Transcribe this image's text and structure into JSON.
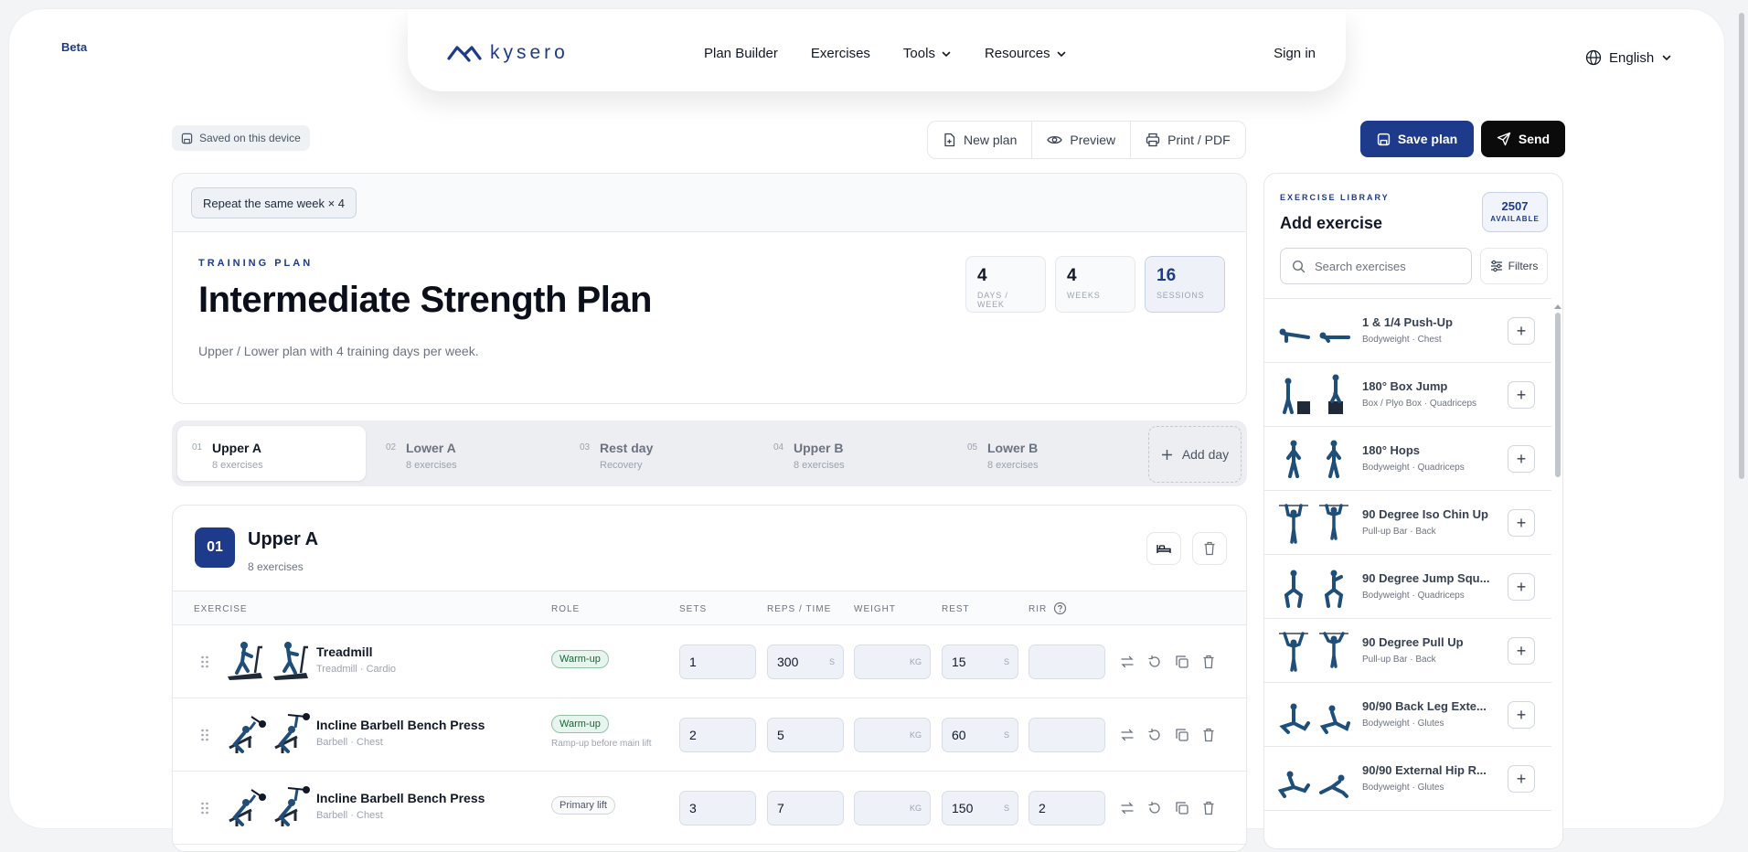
{
  "app": {
    "beta": "Beta",
    "brand": "kysero"
  },
  "nav": {
    "links": [
      {
        "label": "Plan Builder"
      },
      {
        "label": "Exercises"
      },
      {
        "label": "Tools"
      },
      {
        "label": "Resources"
      }
    ],
    "signin": "Sign in",
    "language": "English"
  },
  "toolbar": {
    "saved": "Saved on this device",
    "new_plan": "New plan",
    "preview": "Preview",
    "print": "Print / PDF",
    "save": "Save plan",
    "send": "Send"
  },
  "plan": {
    "repeat": "Repeat the same week × 4",
    "eyebrow": "TRAINING PLAN",
    "title": "Intermediate Strength Plan",
    "description": "Upper / Lower plan with 4 training days per week.",
    "stats": [
      {
        "value": "4",
        "label": "DAYS / WEEK"
      },
      {
        "value": "4",
        "label": "WEEKS"
      },
      {
        "value": "16",
        "label": "SESSIONS"
      }
    ]
  },
  "days": [
    {
      "num": "01",
      "title": "Upper A",
      "sub": "8 exercises"
    },
    {
      "num": "02",
      "title": "Lower A",
      "sub": "8 exercises"
    },
    {
      "num": "03",
      "title": "Rest day",
      "sub": "Recovery"
    },
    {
      "num": "04",
      "title": "Upper B",
      "sub": "8 exercises"
    },
    {
      "num": "05",
      "title": "Lower B",
      "sub": "8 exercises"
    }
  ],
  "add_day": "Add day",
  "current_day": {
    "num": "01",
    "title": "Upper A",
    "sub": "8 exercises"
  },
  "table": {
    "headers": {
      "exercise": "EXERCISE",
      "role": "ROLE",
      "sets": "SETS",
      "reps": "REPS / TIME",
      "weight": "WEIGHT",
      "rest": "REST",
      "rir": "RIR"
    },
    "rows": [
      {
        "name": "Treadmill",
        "meta": "Treadmill · Cardio",
        "role": "Warm-up",
        "role_note": "",
        "sets": "1",
        "reps": "300",
        "reps_unit": "S",
        "weight": "",
        "weight_unit": "KG",
        "rest": "15",
        "rest_unit": "S",
        "rir": ""
      },
      {
        "name": "Incline Barbell Bench Press",
        "meta": "Barbell · Chest",
        "role": "Warm-up",
        "role_note": "Ramp-up before main lift",
        "sets": "2",
        "reps": "5",
        "reps_unit": "",
        "weight": "",
        "weight_unit": "KG",
        "rest": "60",
        "rest_unit": "S",
        "rir": ""
      },
      {
        "name": "Incline Barbell Bench Press",
        "meta": "Barbell · Chest",
        "role": "Primary lift",
        "role_note": "",
        "sets": "3",
        "reps": "7",
        "reps_unit": "",
        "weight": "",
        "weight_unit": "KG",
        "rest": "150",
        "rest_unit": "S",
        "rir": "2"
      }
    ]
  },
  "library": {
    "eyebrow": "EXERCISE LIBRARY",
    "title": "Add exercise",
    "available_count": "2507",
    "available_label": "AVAILABLE",
    "search_placeholder": "Search exercises",
    "filters": "Filters",
    "items": [
      {
        "name": "1 & 1/4 Push-Up",
        "meta": "Bodyweight · Chest"
      },
      {
        "name": "180° Box Jump",
        "meta": "Box / Plyo Box · Quadriceps"
      },
      {
        "name": "180° Hops",
        "meta": "Bodyweight · Quadriceps"
      },
      {
        "name": "90 Degree Iso Chin Up",
        "meta": "Pull-up Bar · Back"
      },
      {
        "name": "90 Degree Jump Squ...",
        "meta": "Bodyweight · Quadriceps"
      },
      {
        "name": "90 Degree Pull Up",
        "meta": "Pull-up Bar · Back"
      },
      {
        "name": "90/90 Back Leg Exte...",
        "meta": "Bodyweight · Glutes"
      },
      {
        "name": "90/90 External Hip R...",
        "meta": "Bodyweight · Glutes"
      }
    ]
  },
  "colors": {
    "brand": "#1e3a8a",
    "send": "#0b0b0b",
    "warmup": "#166534"
  }
}
